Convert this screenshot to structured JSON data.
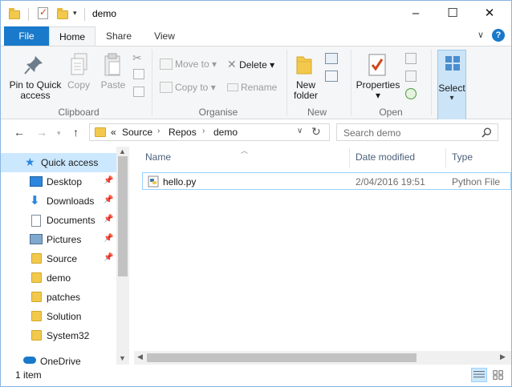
{
  "window": {
    "title": "demo",
    "controls": {
      "minimize": "–",
      "maximize": "☐",
      "close": "✕"
    }
  },
  "ribbon_tabs": {
    "file": "File",
    "home": "Home",
    "share": "Share",
    "view": "View",
    "collapse_glyph": "∨",
    "help_glyph": "?"
  },
  "ribbon": {
    "clipboard": {
      "label": "Clipboard",
      "pin_label_1": "Pin to Quick",
      "pin_label_2": "access",
      "copy": "Copy",
      "paste": "Paste"
    },
    "organise": {
      "label": "Organise",
      "move_to": "Move to",
      "copy_to": "Copy to",
      "delete": "Delete",
      "rename": "Rename",
      "dropdown_glyph": "▾"
    },
    "new": {
      "label": "New",
      "new_folder_1": "New",
      "new_folder_2": "folder"
    },
    "open": {
      "label": "Open",
      "properties": "Properties"
    },
    "select": {
      "label": "Select"
    }
  },
  "address": {
    "overflow": "«",
    "crumbs": [
      "Source",
      "Repos",
      "demo"
    ],
    "crumb_sep": "›",
    "search_placeholder": "Search demo"
  },
  "nav": {
    "quick_access": "Quick access",
    "items": [
      {
        "label": "Desktop",
        "pinned": true
      },
      {
        "label": "Downloads",
        "pinned": true
      },
      {
        "label": "Documents",
        "pinned": true
      },
      {
        "label": "Pictures",
        "pinned": true
      },
      {
        "label": "Source",
        "pinned": true
      },
      {
        "label": "demo",
        "pinned": false
      },
      {
        "label": "patches",
        "pinned": false
      },
      {
        "label": "Solution",
        "pinned": false
      },
      {
        "label": "System32",
        "pinned": false
      }
    ],
    "onedrive": "OneDrive"
  },
  "filelist": {
    "columns": {
      "name": "Name",
      "date_modified": "Date modified",
      "type": "Type"
    },
    "files": [
      {
        "name": "hello.py",
        "date_modified": "2/04/2016 19:51",
        "type": "Python File"
      }
    ]
  },
  "status": {
    "item_count": "1 item"
  },
  "colors": {
    "accent": "#1979ca",
    "selection": "#cce8ff",
    "folder": "#f2c94c"
  }
}
